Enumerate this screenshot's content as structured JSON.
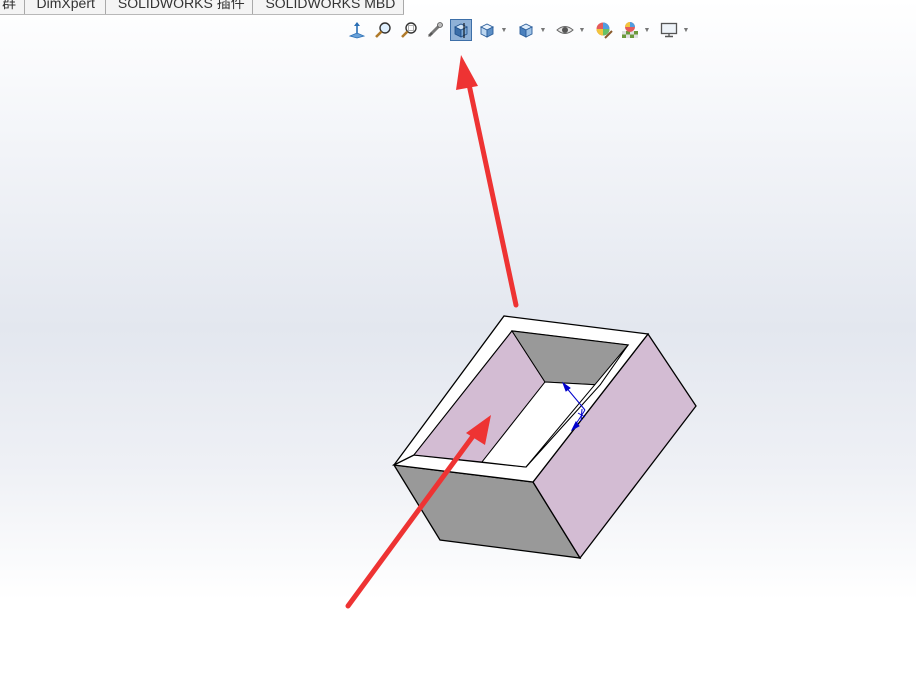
{
  "tabs": [
    {
      "label": "群"
    },
    {
      "label": "DimXpert"
    },
    {
      "label": "SOLIDWORKS 插件"
    },
    {
      "label": "SOLIDWORKS MBD"
    }
  ],
  "heads_up_toolbar": {
    "buttons": [
      {
        "icon": "view-orientation-icon",
        "has_dropdown": false
      },
      {
        "icon": "zoom-to-fit-icon",
        "has_dropdown": false
      },
      {
        "icon": "zoom-to-area-icon",
        "has_dropdown": false
      },
      {
        "icon": "previous-view-icon",
        "has_dropdown": false
      },
      {
        "icon": "section-view-icon",
        "has_dropdown": false,
        "active": true
      },
      {
        "icon": "view-orientation-cube-icon",
        "has_dropdown": true
      },
      {
        "icon": "display-style-icon",
        "has_dropdown": true
      },
      {
        "icon": "hide-show-items-icon",
        "has_dropdown": true
      },
      {
        "icon": "edit-appearance-icon",
        "has_dropdown": false
      },
      {
        "icon": "apply-scene-icon",
        "has_dropdown": true
      },
      {
        "icon": "view-settings-monitor-icon",
        "has_dropdown": true
      }
    ]
  },
  "model": {
    "name": "rectangular hollow box with pocket",
    "colors": {
      "face_top": "#ffffff",
      "face_pink": "#d3bcd3",
      "face_gray": "#999999",
      "edge": "#000000",
      "dimension": "#0000cc",
      "annotation_arrow": "#ee3333"
    }
  }
}
